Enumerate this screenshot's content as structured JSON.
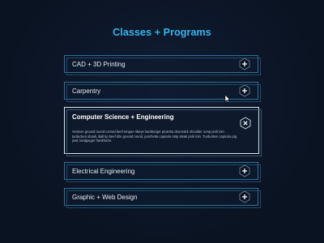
{
  "page": {
    "title": "Classes + Programs"
  },
  "accordion": {
    "items": [
      {
        "label": "CAD + 3D Printing",
        "expanded": false,
        "icon": "plus-icon"
      },
      {
        "label": "Carpentry",
        "expanded": false,
        "icon": "plus-icon"
      },
      {
        "label": "Computer Science + Engineering",
        "expanded": true,
        "icon": "close-icon",
        "body": "Venison ground round corned beef tongue ribeye hamburger picanha drumstick shoulder rump pork loin turducken shank. Ball tip beef ribs ground round, porchetta capicola strip steak pork loin. Turducken capicola pig jowl, landjaeger frankfurter."
      },
      {
        "label": "Electrical Engineering",
        "expanded": false,
        "icon": "plus-icon"
      },
      {
        "label": "Graphic + Web Design",
        "expanded": false,
        "icon": "plus-icon"
      }
    ]
  },
  "colors": {
    "background": "#0b1424",
    "accent": "#36b4ec",
    "border": "#2f6f95",
    "expanded_border": "#d9e2ea"
  }
}
